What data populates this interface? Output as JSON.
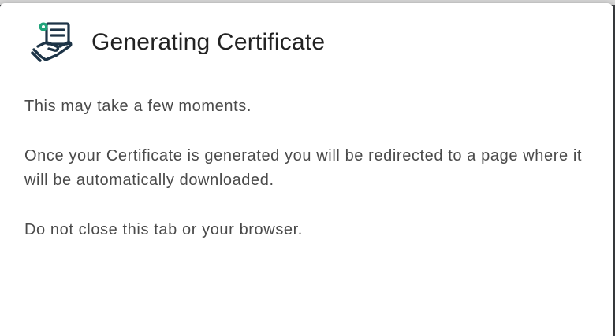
{
  "dialog": {
    "title": "Generating Certificate",
    "icon": "certificate-hand-icon",
    "paragraphs": {
      "p1": "This may take a few moments.",
      "p2": "Once your Certificate is generated you will be redirected to a page where it will be automatically downloaded.",
      "p3": "Do not close this tab or your browser."
    }
  },
  "colors": {
    "icon_dark": "#1d3447",
    "icon_accent": "#1fa37a",
    "title_text": "#222222",
    "body_text": "#4a4a4a",
    "overlay": "#3f4246"
  }
}
